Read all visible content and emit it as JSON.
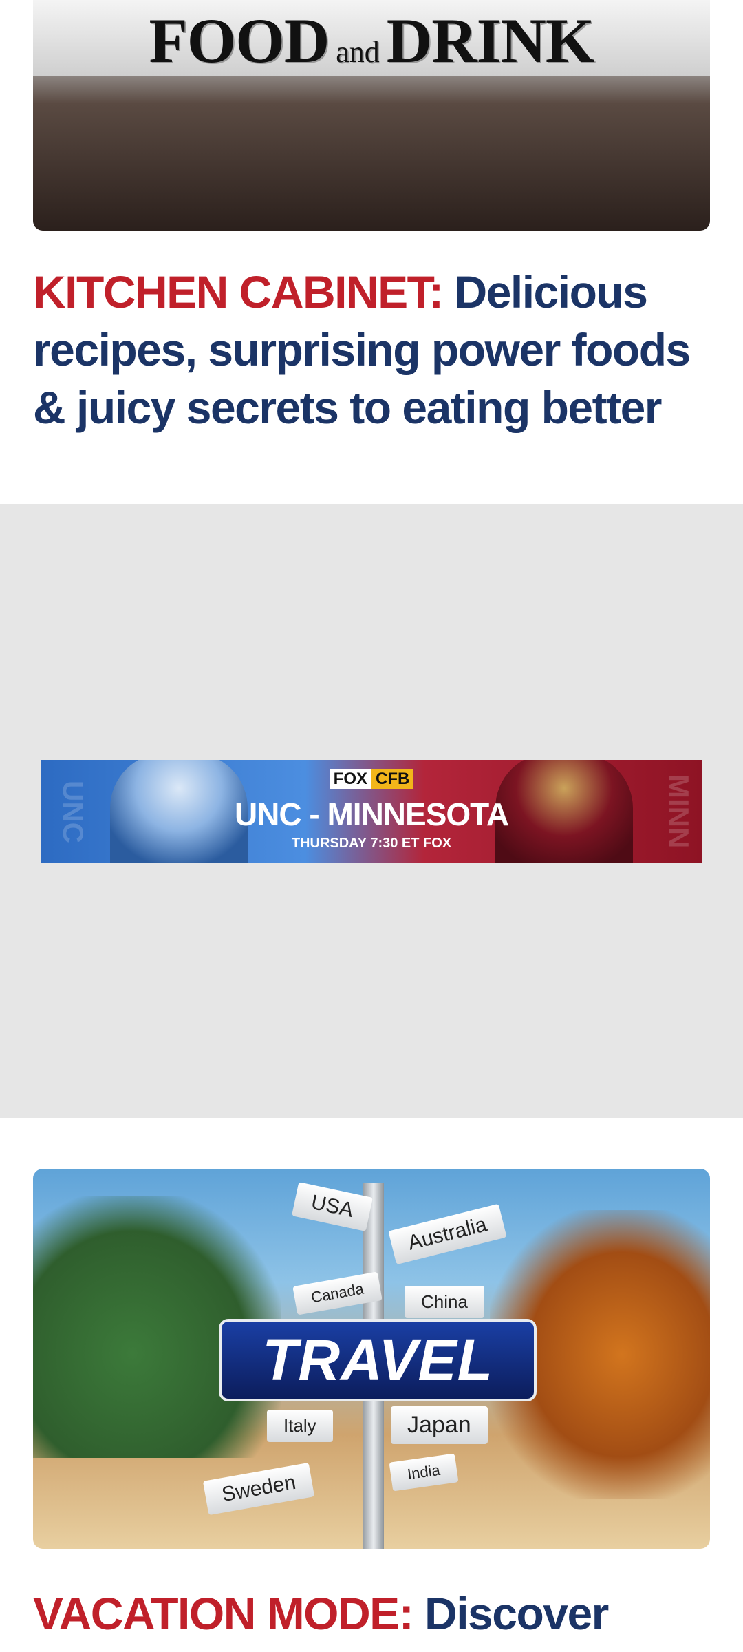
{
  "article1": {
    "image_logo_big1": "FOOD",
    "image_logo_small": "and",
    "image_logo_big2": "DRINK",
    "kicker": "KITCHEN CABINET:",
    "title": "Delicious recipes, surprising power foods & juicy secrets to eating better"
  },
  "ad": {
    "brand_fox": "FOX",
    "brand_cfb": "CFB",
    "matchup": "UNC - MINNESOTA",
    "when": "THURSDAY 7:30 ET FOX",
    "side_left": "UNC",
    "side_right": "MINN"
  },
  "article2": {
    "image_title": "TRAVEL",
    "signs": [
      "USA",
      "Australia",
      "Canada",
      "China",
      "Italy",
      "Japan",
      "India",
      "Sweden"
    ],
    "kicker": "VACATION MODE:",
    "title": "Discover"
  },
  "colors": {
    "kicker": "#c0202a",
    "headline": "#1b3466",
    "ad_background": "#e6e6e6"
  }
}
